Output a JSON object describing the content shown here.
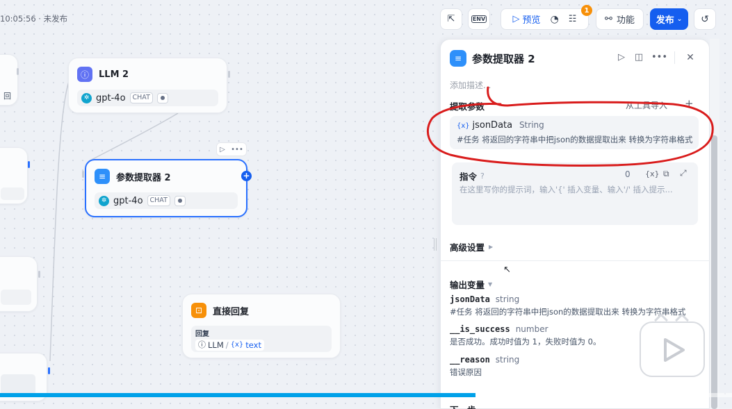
{
  "header": {
    "status_text": "10:05:56 · 未发布",
    "preview_label": "预览",
    "checklist_badge": "1",
    "features_label": "功能",
    "publish_label": "发布",
    "env_label": "ENV"
  },
  "canvas": {
    "llm_node": {
      "title": "LLM 2",
      "model": "gpt-4o",
      "mode": "CHAT"
    },
    "extractor_node": {
      "title": "参数提取器 2",
      "model": "gpt-4o",
      "mode": "CHAT"
    },
    "answer_node": {
      "title": "直接回复",
      "reply_label": "回复",
      "source_node": "LLM",
      "separator": "/",
      "source_var": "text"
    },
    "partial_left_text": "回"
  },
  "panel": {
    "title": "参数提取器 2",
    "description_placeholder": "添加描述...",
    "extract_section": {
      "title": "提取参数",
      "import_label": "从工具导入",
      "add_label": "+"
    },
    "param": {
      "name": "jsonData",
      "type": "String",
      "description": "#任务 将返回的字符串中把json的数据提取出来 转换为字符串格式"
    },
    "instruction": {
      "title": "指令",
      "count": "0",
      "placeholder": "在这里写你的提示词，输入'{' 插入变量、输入'/' 插入提示..."
    },
    "advanced_label": "高级设置",
    "output_section": {
      "title": "输出变量",
      "vars": [
        {
          "name": "jsonData",
          "type": "string",
          "description": "#任务 将返回的字符串中把json的数据提取出来 转换为字符串格式"
        },
        {
          "name": "__is_success",
          "type": "number",
          "description": "是否成功。成功时值为 1，失败时值为 0。"
        },
        {
          "name": "__reason",
          "type": "string",
          "description": "错误原因"
        }
      ]
    },
    "next_step_label": "下一步"
  },
  "video": {
    "progress": 0.65
  },
  "colors": {
    "accent": "#155eef",
    "annotation_red": "#d91c1c",
    "progress": "#00a1e9",
    "warning_badge": "#f79009"
  },
  "icons": {
    "llm": "info-circle-icon",
    "extractor": "list-icon",
    "answer": "chat-reply-icon",
    "model": "openai-icon"
  }
}
